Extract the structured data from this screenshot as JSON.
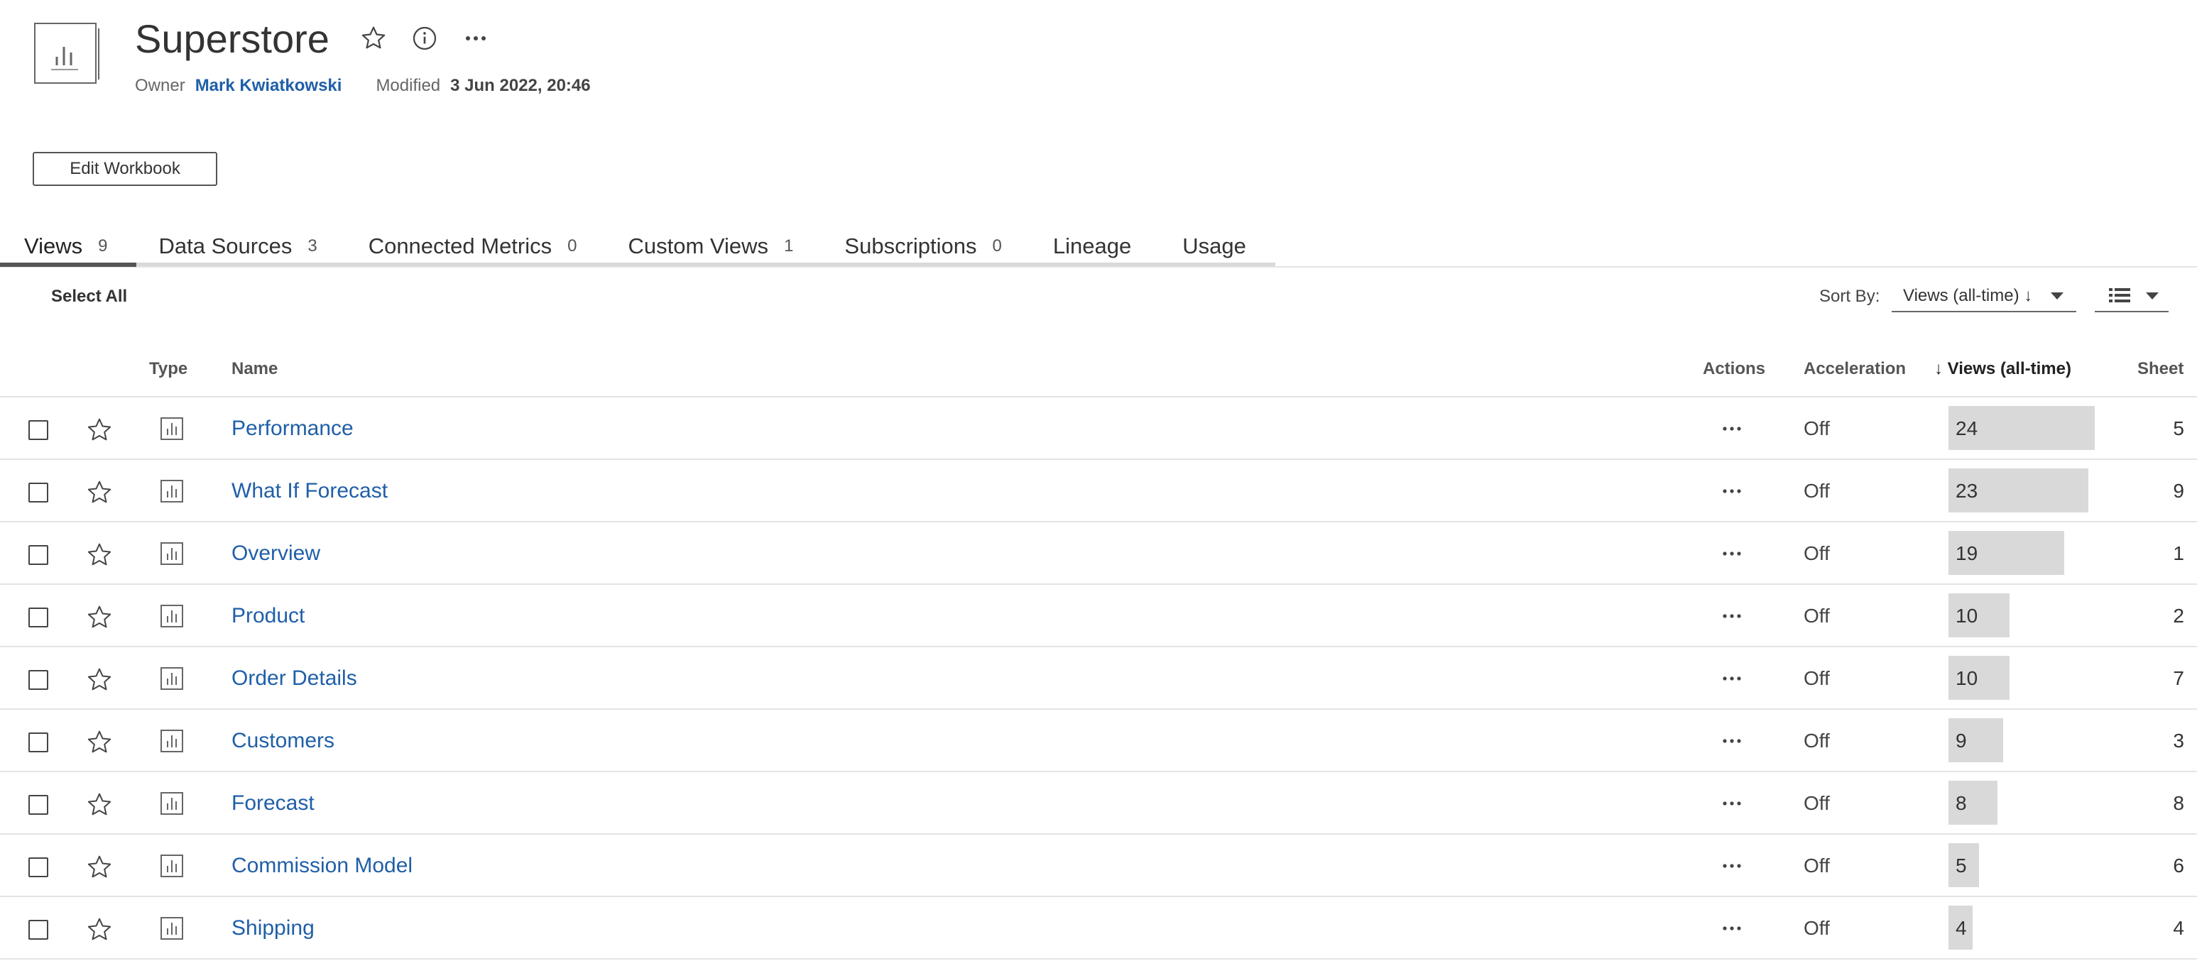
{
  "header": {
    "title": "Superstore",
    "owner_label": "Owner",
    "owner_name": "Mark Kwiatkowski",
    "modified_label": "Modified",
    "modified_date": "3 Jun 2022, 20:46",
    "edit_button": "Edit Workbook",
    "icons": [
      "workbook-chart-icon",
      "star-icon",
      "info-icon",
      "more-icon"
    ]
  },
  "tabs": [
    {
      "label": "Views",
      "count": "9",
      "active": true
    },
    {
      "label": "Data Sources",
      "count": "3"
    },
    {
      "label": "Connected Metrics",
      "count": "0"
    },
    {
      "label": "Custom Views",
      "count": "1"
    },
    {
      "label": "Subscriptions",
      "count": "0"
    },
    {
      "label": "Lineage",
      "count": ""
    },
    {
      "label": "Usage",
      "count": ""
    }
  ],
  "toolbar": {
    "select_all": "Select All",
    "sort_by_label": "Sort By:",
    "sort_value": "Views (all-time) ↓",
    "view_mode_icon": "list-view-icon"
  },
  "table": {
    "columns": {
      "type": "Type",
      "name": "Name",
      "actions": "Actions",
      "acceleration": "Acceleration",
      "views": "↓ Views (all-time)",
      "sheet": "Sheet"
    },
    "max_views": 24,
    "rows": [
      {
        "name": "Performance",
        "acceleration": "Off",
        "views": 24,
        "sheet": "5"
      },
      {
        "name": "What If Forecast",
        "acceleration": "Off",
        "views": 23,
        "sheet": "9"
      },
      {
        "name": "Overview",
        "acceleration": "Off",
        "views": 19,
        "sheet": "1"
      },
      {
        "name": "Product",
        "acceleration": "Off",
        "views": 10,
        "sheet": "2"
      },
      {
        "name": "Order Details",
        "acceleration": "Off",
        "views": 10,
        "sheet": "7"
      },
      {
        "name": "Customers",
        "acceleration": "Off",
        "views": 9,
        "sheet": "3"
      },
      {
        "name": "Forecast",
        "acceleration": "Off",
        "views": 8,
        "sheet": "8"
      },
      {
        "name": "Commission Model",
        "acceleration": "Off",
        "views": 5,
        "sheet": "6"
      },
      {
        "name": "Shipping",
        "acceleration": "Off",
        "views": 4,
        "sheet": "4"
      }
    ]
  },
  "colors": {
    "link": "#1f5fa8",
    "bar": "#d9d9d9",
    "active_tab": "#555555"
  }
}
